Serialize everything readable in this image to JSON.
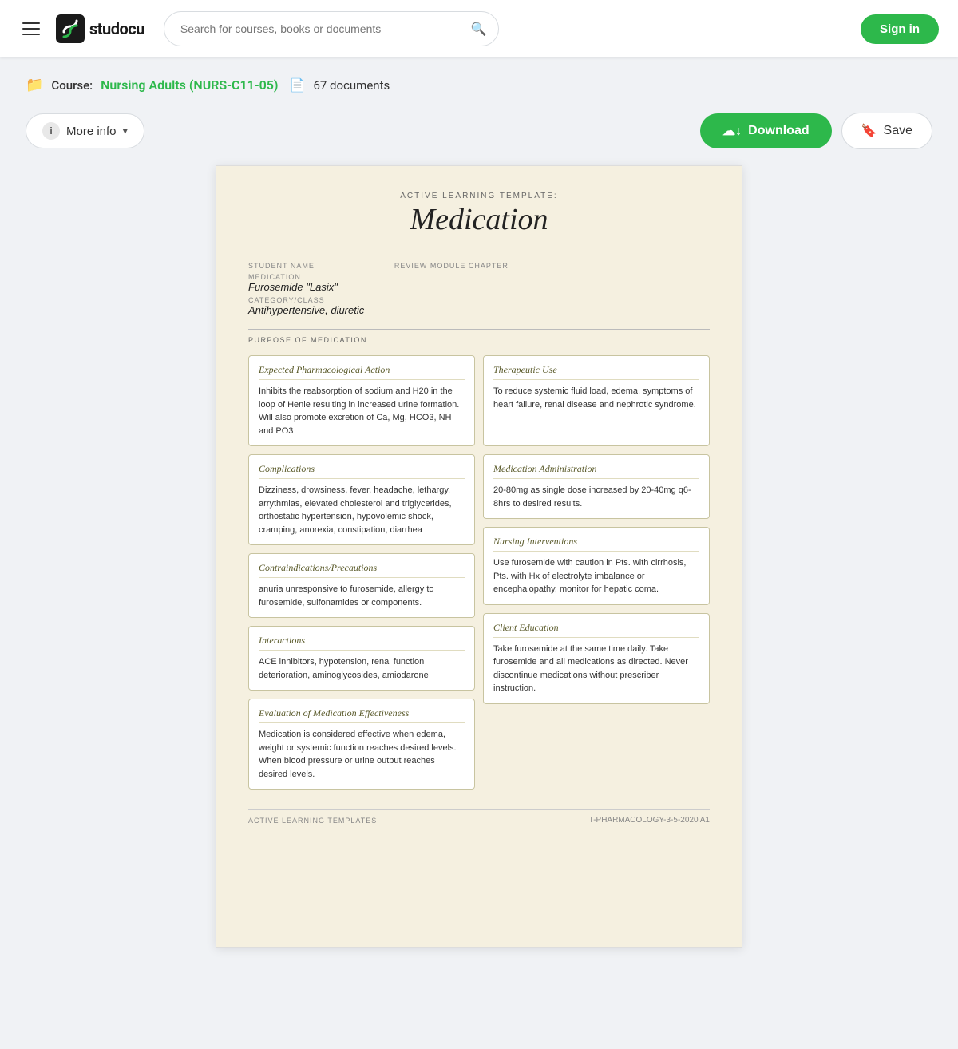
{
  "header": {
    "search_placeholder": "Search for courses, books or documents",
    "sign_in_label": "Sign in",
    "logo_text": "studocu"
  },
  "breadcrumb": {
    "prefix": "Course:",
    "course_name": "Nursing Adults (NURS-C11-05)",
    "doc_count": "67 documents"
  },
  "actions": {
    "more_info_label": "More info",
    "download_label": "Download",
    "save_label": "Save"
  },
  "document": {
    "template_label": "ACTIVE LEARNING TEMPLATE:",
    "title": "Medication",
    "meta": {
      "student_name_label": "STUDENT NAME",
      "student_name_value": "",
      "medication_label": "MEDICATION",
      "medication_value": "Furosemide \"Lasix\"",
      "category_label": "CATEGORY/CLASS",
      "category_value": "Antihypertensive, diuretic",
      "review_module_label": "REVIEW MODULE CHAPTER",
      "review_module_value": ""
    },
    "section_label": "PURPOSE OF MEDICATION",
    "cards": {
      "pharmacological": {
        "title": "Expected Pharmacological Action",
        "content": "Inhibits the reabsorption of sodium and H20 in the loop of Henle resulting in increased urine formation. Will also promote excretion of Ca, Mg, HCO3, NH and PO3"
      },
      "therapeutic": {
        "title": "Therapeutic Use",
        "content": "To reduce systemic fluid load, edema, symptoms of heart failure, renal disease and nephrotic syndrome."
      },
      "complications": {
        "title": "Complications",
        "content": "Dizziness, drowsiness, fever, headache, lethargy, arrythmias, elevated cholesterol and triglycerides, orthostatic hypertension, hypovolemic shock, cramping, anorexia, constipation, diarrhea"
      },
      "administration": {
        "title": "Medication Administration",
        "content": "20-80mg as single dose increased by 20-40mg q6-8hrs to desired results."
      },
      "contraindications": {
        "title": "Contraindications/Precautions",
        "content": "anuria unresponsive to furosemide, allergy to furosemide, sulfonamides or components."
      },
      "nursing_interventions": {
        "title": "Nursing Interventions",
        "content": "Use furosemide with caution in Pts. with cirrhosis, Pts. with Hx of electrolyte imbalance or encephalopathy, monitor for hepatic coma."
      },
      "interactions": {
        "title": "Interactions",
        "content": "ACE inhibitors, hypotension, renal function deterioration, aminoglycosides, amiodarone"
      },
      "client_education": {
        "title": "Client Education",
        "content": "Take furosemide at the same time daily. Take furosemide and all medications as directed. Never discontinue medications without prescriber instruction."
      },
      "evaluation": {
        "title": "Evaluation of Medication Effectiveness",
        "content": "Medication is considered effective when edema, weight or systemic function reaches desired levels. When blood pressure or urine output reaches desired levels."
      }
    },
    "footer_label": "ACTIVE LEARNING TEMPLATES",
    "footer_page": "T-PHARMACOLOGY-3-5-2020   A1"
  }
}
